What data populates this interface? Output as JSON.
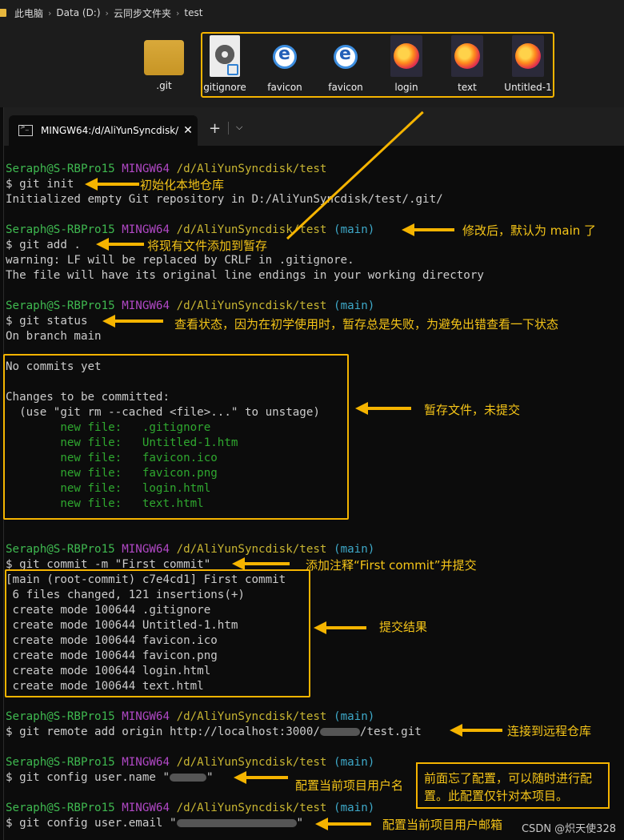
{
  "explorer": {
    "breadcrumb": [
      "此电脑",
      "Data (D:)",
      "云同步文件夹",
      "test"
    ],
    "files": [
      {
        "label": ".git",
        "icon": "folder-icon"
      },
      {
        "label": "gitignore",
        "icon": "config-file-icon"
      },
      {
        "label": "favicon",
        "icon": "ie-icon"
      },
      {
        "label": "favicon",
        "icon": "ie-icon"
      },
      {
        "label": "login",
        "icon": "firefox-icon"
      },
      {
        "label": "text",
        "icon": "firefox-icon"
      },
      {
        "label": "Untitled-1",
        "icon": "firefox-icon"
      }
    ]
  },
  "terminal": {
    "tab_title": "MINGW64:/d/AliYunSyncdisk/",
    "tab_close": "✕",
    "new_tab": "+",
    "dropdown": "⌵",
    "prompt": {
      "user": "Seraph@S-RBPro15",
      "shell": "MINGW64",
      "path": "/d/AliYunSyncdisk/test",
      "branch": "(main)"
    },
    "lines": {
      "cmd_init": "$ git init",
      "out_init": "Initialized empty Git repository in D:/AliYunSyncdisk/test/.git/",
      "cmd_add": "$ git add .",
      "out_add_1": "warning: LF will be replaced by CRLF in .gitignore.",
      "out_add_2": "The file will have its original line endings in your working directory",
      "cmd_status": "$ git status",
      "out_branch": "On branch main",
      "no_commits": "No commits yet",
      "changes": "Changes to be committed:",
      "use_hint": "  (use \"git rm --cached <file>...\" to unstage)",
      "new_file_label": "        new file:   ",
      "new_files": [
        ".gitignore",
        "Untitled-1.htm",
        "favicon.ico",
        "favicon.png",
        "login.html",
        "text.html"
      ],
      "cmd_commit": "$ git commit -m \"First commit\"",
      "commit_head": "[main (root-commit) c7e4cd1] First commit",
      "commit_stats": " 6 files changed, 121 insertions(+)",
      "create_mode_label": " create mode 100644 ",
      "cmd_remote_a": "$ git remote add origin http://localhost:3000/",
      "cmd_remote_b": "/test.git",
      "cmd_name_a": "$ git config user.name \"",
      "cmd_name_b": "\"",
      "cmd_email_a": "$ git config user.email \"",
      "cmd_email_b": "\""
    }
  },
  "annotations": {
    "init": "初始化本地仓库",
    "add": "将现有文件添加到暂存",
    "default_main": "修改后，默认为 main 了",
    "status": "查看状态，因为在初学使用时，暂存总是失败，为避免出错查看一下状态",
    "staged": "暂存文件，未提交",
    "commit": "添加注释“First commit”并提交",
    "commit_result": "提交结果",
    "remote": "连接到远程仓库",
    "config_name": "配置当前项目用户名",
    "config_email": "配置当前项目用户邮箱",
    "config_callout": "前面忘了配置，可以随时进行配置。此配置仅针对本项目。"
  },
  "watermark": "CSDN @炽天使328",
  "colors": {
    "highlight": "#f5b400",
    "prompt_user": "#3fb950",
    "prompt_shell": "#b148c6",
    "prompt_path": "#c8b532",
    "prompt_branch": "#3ea9c9",
    "staged_file": "#2fa82f"
  }
}
